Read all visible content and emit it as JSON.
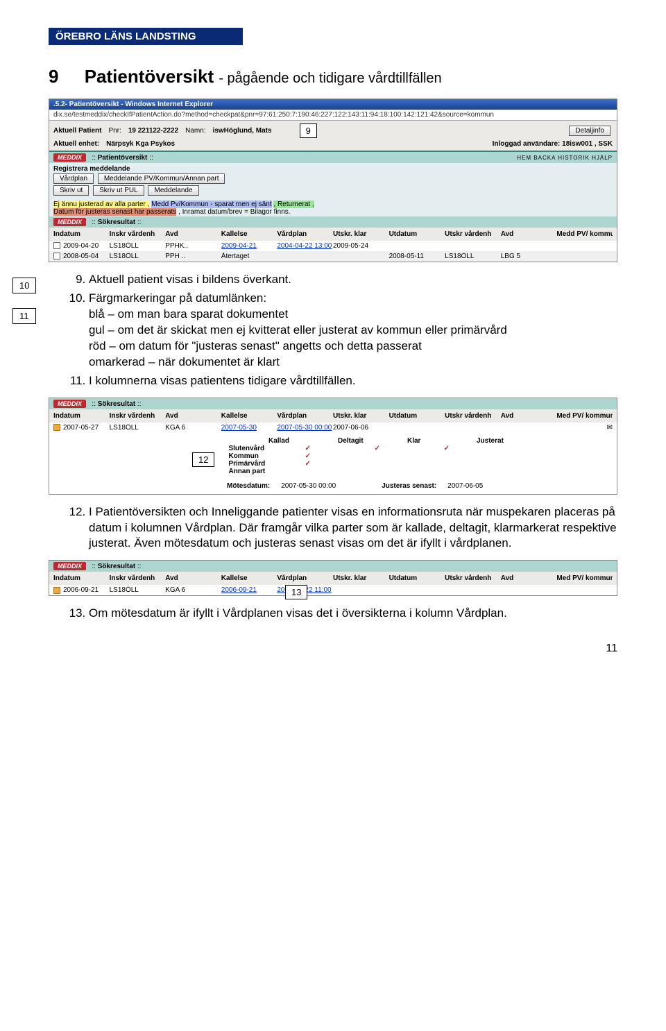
{
  "org": {
    "name": "ÖREBRO LÄNS LANDSTING"
  },
  "title": {
    "num": "9",
    "main": "Patientöversikt",
    "sub": "- pågående och tidigare vårdtillfällen"
  },
  "boxes": {
    "b9": "9",
    "b10": "10",
    "b11": "11",
    "b12": "12",
    "b13": "13"
  },
  "shot1": {
    "titlebar": ".5.2- Patientöversikt - Windows Internet Explorer",
    "url": "dix.se/testmeddix/checkIfPatientAction.do?method=checkpat&pnr=97:61:250:7:190:46:227:122:143:11:94:18:100:142:121:42&source=kommun",
    "ak_pat": "Aktuell Patient",
    "pnr_lbl": "Pnr:",
    "pnr_val": "19 221122-2222",
    "namn_lbl": "Namn:",
    "namn_val": "iswHöglund, Mats",
    "detalj": "Detaljinfo",
    "enhet_lbl": "Aktuell enhet:",
    "enhet_val": "Närpsyk Kga Psykos",
    "inlgd_lbl": "Inloggad användare:",
    "inlgd_val": "18isw001 , SSK",
    "hd1": "Patientöversikt",
    "toolbar_icons": [
      "HEM",
      "BACKA",
      "HISTORIK",
      "HJÄLP"
    ],
    "reg": "Registrera meddelande",
    "b_vardplan": "Vårdplan",
    "b_medd": "Meddelande PV/Kommun/Annan part",
    "b_skriv": "Skriv ut",
    "b_pul": "Skriv ut PUL",
    "b_medd2": "Meddelande",
    "legend_pre": "Ej ännu justerad av alla parter ,",
    "legend_blue": "Medd Pv/Kommun - sparat men ej sänt",
    "legend_green": ", Returnerat ,",
    "legend_red": "Datum för justeras senast har passerats",
    "legend_post": ", Inramat datum/brev = Bilagor finns.",
    "hd2": "Sökresultat",
    "cols": [
      "Indatum",
      "Inskr vårdenh",
      "Avd",
      "Kallelse",
      "Vårdplan",
      "Utskr. klar",
      "Utdatum",
      "Utskr vårdenh",
      "Avd",
      "Medd PV/ kommun"
    ],
    "row1": [
      "2009-04-20",
      "LS18ÖLL",
      "PPHK..",
      "2009-04-21",
      "2004-04-22 13:00",
      "2009-05-24",
      "",
      "",
      "",
      ""
    ],
    "row2": [
      "2008-05-04",
      "LS18ÖLL",
      "PPH ..",
      "Återtaget",
      "",
      "",
      "2008-05-11",
      "LS18ÖLL",
      "LBG 5",
      ""
    ]
  },
  "body1": {
    "n9": "Aktuell patient visas i bildens överkant.",
    "n10": "Färgmarkeringar på datumlänken:",
    "n10a": "blå – om man bara sparat dokumentet",
    "n10b": "gul – om det är skickat men ej kvitterat eller justerat av kommun eller primärvård",
    "n10c": "röd – om datum för \"justeras senast\" angetts och detta passerat",
    "n10d": "omarkerad – när dokumentet är klart",
    "n11": "I kolumnerna visas patientens tidigare vårdtillfällen."
  },
  "shot2": {
    "hd": "Sökresultat",
    "cols": [
      "Indatum",
      "Inskr vårdenh",
      "Avd",
      "Kallelse",
      "Vårdplan",
      "Utskr. klar",
      "Utdatum",
      "Utskr vårdenh",
      "Avd",
      "Med PV/ kommun"
    ],
    "row": [
      "2007-05-27",
      "LS18ÖLL",
      "KGA 6",
      "2007-05-30",
      "2007-05-30 00:00",
      "2007-06-06",
      "",
      "",
      "",
      ""
    ],
    "pop_hdr": [
      "Kallad",
      "Deltagit",
      "Klar",
      "Justerat"
    ],
    "pop_rows": [
      {
        "label": "Slutenvård",
        "k": "✓",
        "d": "✓",
        "kl": "✓",
        "j": ""
      },
      {
        "label": "Kommun",
        "k": "✓",
        "d": "",
        "kl": "",
        "j": ""
      },
      {
        "label": "Primärvård",
        "k": "✓",
        "d": "",
        "kl": "",
        "j": ""
      },
      {
        "label": "Annan part",
        "k": "",
        "d": "",
        "kl": "",
        "j": ""
      }
    ],
    "motes_l": "Mötesdatum:",
    "motes_v": "2007-05-30 00:00",
    "just_l": "Justeras senast:",
    "just_v": "2007-06-05"
  },
  "body2": {
    "n12": "I Patientöversikten och Inneliggande patienter visas en informationsruta när muspekaren placeras på datum i kolumnen Vårdplan. Där framgår vilka parter som är kallade, deltagit, klarmarkerat respektive justerat. Även mötesdatum och justeras senast visas om det är ifyllt i vårdplanen."
  },
  "shot3": {
    "hd": "Sökresultat",
    "cols": [
      "Indatum",
      "Inskr vårdenh",
      "Avd",
      "Kallelse",
      "Vårdplan",
      "Utskr. klar",
      "Utdatum",
      "Utskr vårdenh",
      "Avd",
      "Med PV/ kommun"
    ],
    "row": [
      "2006-09-21",
      "LS18ÖLL",
      "KGA 6",
      "2006-09-21",
      "2006-09-22 11:00",
      "",
      "",
      "",
      "",
      ""
    ]
  },
  "body3": {
    "n13": "Om mötesdatum är ifyllt i Vårdplanen visas det i översikterna i kolumn Vårdplan."
  },
  "page_num": "11"
}
